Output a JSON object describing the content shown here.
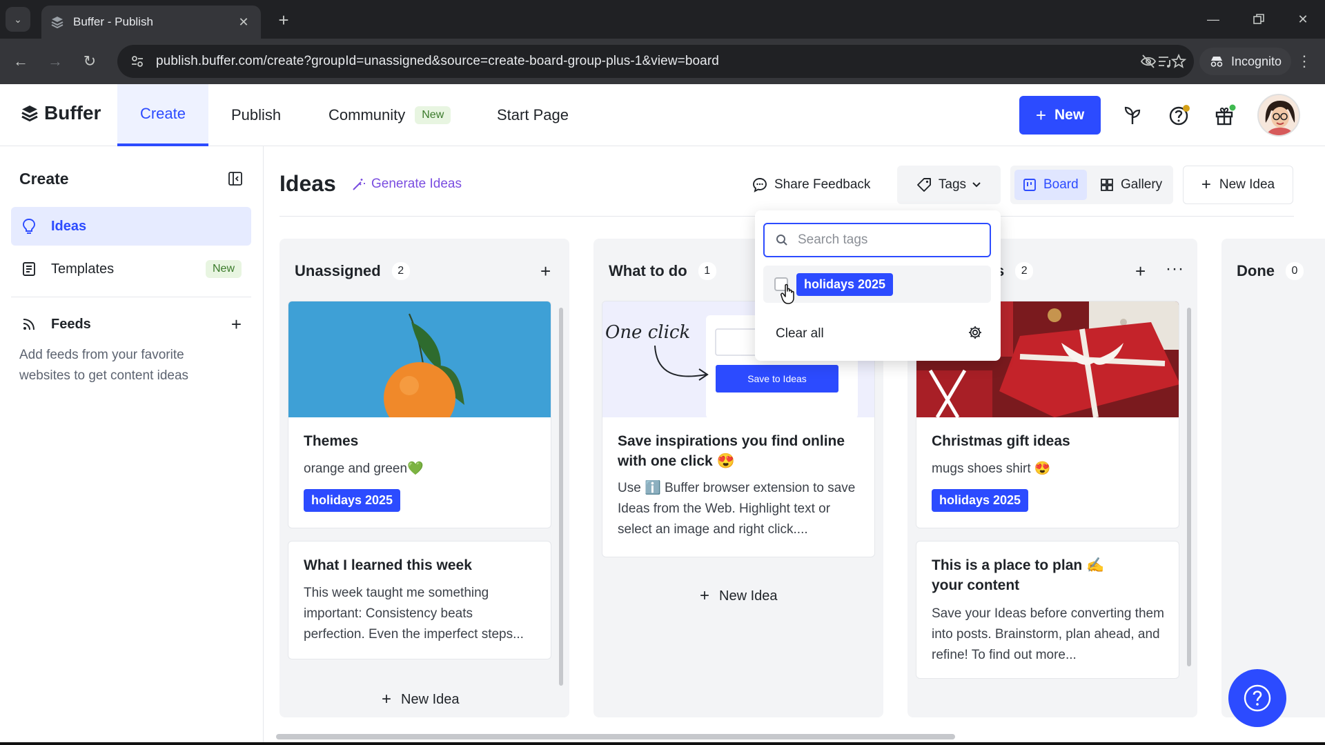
{
  "browser": {
    "tab_title": "Buffer - Publish",
    "url": "publish.buffer.com/create?groupId=unassigned&source=create-board-group-plus-1&view=board",
    "incognito_label": "Incognito"
  },
  "header": {
    "logo": "Buffer",
    "nav": [
      {
        "label": "Create"
      },
      {
        "label": "Publish"
      },
      {
        "label": "Community",
        "badge": "New"
      },
      {
        "label": "Start Page"
      }
    ],
    "new_button": "New",
    "accent_color": "#2c4bff"
  },
  "sidebar": {
    "title": "Create",
    "items": [
      {
        "label": "Ideas"
      },
      {
        "label": "Templates",
        "badge": "New"
      },
      {
        "label": "Feeds"
      }
    ],
    "feeds_note": "Add feeds from your favorite websites to get content ideas"
  },
  "main": {
    "title": "Ideas",
    "generate_ideas": "Generate Ideas",
    "share_feedback": "Share Feedback",
    "tags_button": "Tags",
    "view_board": "Board",
    "view_gallery": "Gallery",
    "new_idea": "New Idea"
  },
  "tags_dropdown": {
    "search_placeholder": "Search tags",
    "tag": "holidays 2025",
    "clear_all": "Clear all"
  },
  "columns": [
    {
      "name": "Unassigned",
      "count": "2",
      "cards": [
        {
          "title": "Themes",
          "text": "orange and green💚",
          "tag": "holidays 2025"
        },
        {
          "title": "What I learned this week",
          "text": "This week taught me something important: Consistency beats perfection. Even the imperfect steps..."
        }
      ],
      "new_idea": "New Idea"
    },
    {
      "name": "What to do",
      "count": "1",
      "cards": [
        {
          "title": "Save inspirations you find online with one click 😍",
          "text": "Use ℹ️ Buffer browser extension to save Ideas from the Web. Highlight text or select an image and right click....",
          "image_text": "One click",
          "image_button": "Save to Ideas"
        }
      ],
      "new_idea": "New Idea"
    },
    {
      "name": "s",
      "count": "2",
      "cards": [
        {
          "title": "Christmas gift ideas",
          "text": "mugs shoes shirt 😍",
          "tag": "holidays 2025"
        },
        {
          "title": "This is a place to plan ✍️ your content",
          "text": "Save your Ideas before converting them into posts. Brainstorm, plan ahead, and refine! To find out more..."
        }
      ]
    },
    {
      "name": "Done",
      "count": "0"
    }
  ]
}
